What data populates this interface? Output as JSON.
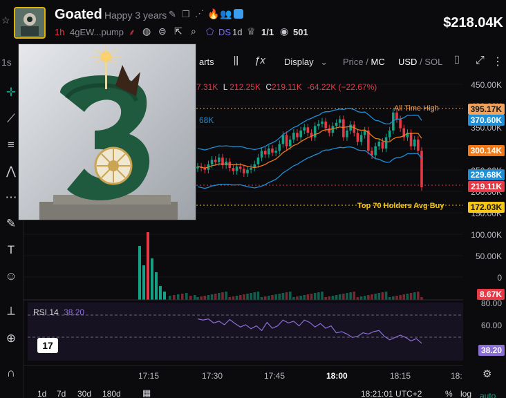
{
  "header": {
    "star_icon": "star-icon",
    "token_name": "Goated",
    "tagline": "Happy 3 years",
    "timeframe": "1h",
    "address": "4gEW...pump",
    "ds_label": "DS",
    "age": "1d",
    "holders_ratio": "1/1",
    "views": "501",
    "market_cap": "$218.04K"
  },
  "toolbar": {
    "timeframe_side": "1s",
    "charts_label": "arts",
    "display_label": "Display",
    "price_label": "Price",
    "mc_label": "MC",
    "usd_label": "USD",
    "sol_label": "SOL"
  },
  "ohlc": {
    "h_value": "7.31K",
    "l_label": "L",
    "l_value": "212.25K",
    "c_label": "C",
    "c_value": "219.11K",
    "change": "-64.22K (−22.67%)",
    "bb_value": "68K"
  },
  "annotations": {
    "ath": "All Time High",
    "holders": "Top 70 Holders Avg Buy"
  },
  "price_axis": {
    "ticks": [
      "450.00K",
      "400.00K",
      "350.00K",
      "300.00K",
      "250.00K",
      "200.00K",
      "150.00K",
      "100.00K",
      "50.00K",
      "0"
    ],
    "badges": [
      {
        "text": "395.17K",
        "color": "#f0a35e",
        "kind": "ath"
      },
      {
        "text": "370.60K",
        "color": "#1e8fd6",
        "kind": "bb-upper"
      },
      {
        "text": "300.14K",
        "color": "#f07a1a",
        "kind": "ma"
      },
      {
        "text": "229.68K",
        "color": "#1e8fd6",
        "kind": "bb-lower"
      },
      {
        "text": "219.11K",
        "color": "#e63946",
        "kind": "last"
      },
      {
        "text": "172.03K",
        "color": "#f5c518",
        "kind": "holders"
      }
    ],
    "volume_badge": "8.67K"
  },
  "rsi": {
    "label": "RSI",
    "period": "14",
    "value": "38.20",
    "ticks": [
      "80.00",
      "60.00",
      "40.00"
    ],
    "badge": "38.20"
  },
  "time_axis": [
    "17:15",
    "17:30",
    "17:45",
    "18:00",
    "18:15",
    "18:"
  ],
  "bottom": {
    "ranges": [
      "1d",
      "7d",
      "30d",
      "180d"
    ],
    "clock": "18:21:01 UTC+2",
    "pct": "%",
    "log": "log",
    "auto": "auto"
  },
  "colors": {
    "up": "#16a085",
    "down": "#e63946",
    "bb": "#1e8fd6",
    "ma": "#f07a1a",
    "rsi": "#8c6fd6"
  },
  "chart_data": {
    "type": "line",
    "ylabel": "",
    "ylim": [
      0,
      460000
    ],
    "candles_close": [
      265000,
      262000,
      258000,
      270000,
      280000,
      275000,
      285000,
      268000,
      276000,
      262000,
      255000,
      265000,
      260000,
      250000,
      258000,
      262000,
      270000,
      285000,
      300000,
      292000,
      305000,
      296000,
      300000,
      315000,
      335000,
      310000,
      325000,
      340000,
      330000,
      345000,
      352000,
      340000,
      330000,
      355000,
      360000,
      365000,
      350000,
      340000,
      355000,
      362000,
      370000,
      330000,
      345000,
      358000,
      340000,
      320000,
      335000,
      345000,
      300000,
      290000,
      310000,
      320000,
      305000,
      330000,
      345000,
      385000,
      370000,
      350000,
      330000,
      340000,
      310000,
      325000,
      300000,
      219110
    ],
    "rsi_values": [
      72,
      70,
      72,
      65,
      68,
      62,
      71,
      64,
      58,
      62,
      55,
      60,
      52,
      66,
      56,
      60,
      70,
      65,
      68,
      60,
      70,
      66,
      58,
      64,
      56,
      60,
      48,
      50,
      46,
      40,
      42,
      48,
      46,
      50,
      52,
      42,
      36,
      40,
      44,
      40,
      34,
      38,
      30
    ]
  }
}
